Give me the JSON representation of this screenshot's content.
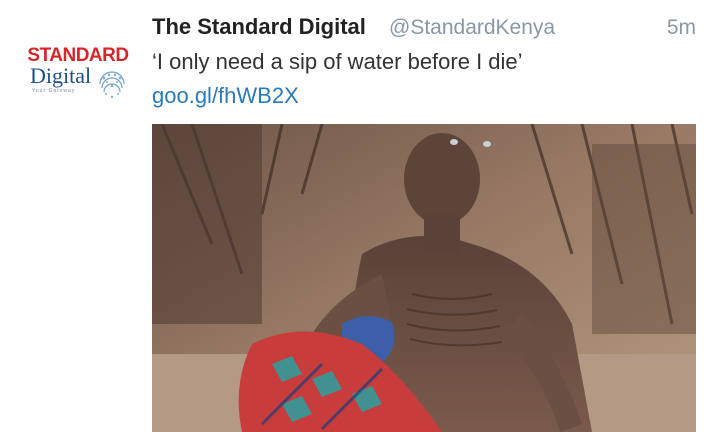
{
  "tweet": {
    "account_name": "The Standard Digital",
    "handle": "@StandardKenya",
    "timestamp": "5m",
    "text": "‘I only need a sip of water before I die’",
    "link": "goo.gl/fhWB2X"
  },
  "avatar": {
    "logo_top": "STANDARD",
    "logo_bottom": "Digital",
    "logo_tagline": "Your Gateway"
  },
  "colors": {
    "brand_red": "#d7262b",
    "brand_blue": "#1d4f8a",
    "link_blue": "#2b7bb9",
    "meta_gray": "#8899a6"
  }
}
